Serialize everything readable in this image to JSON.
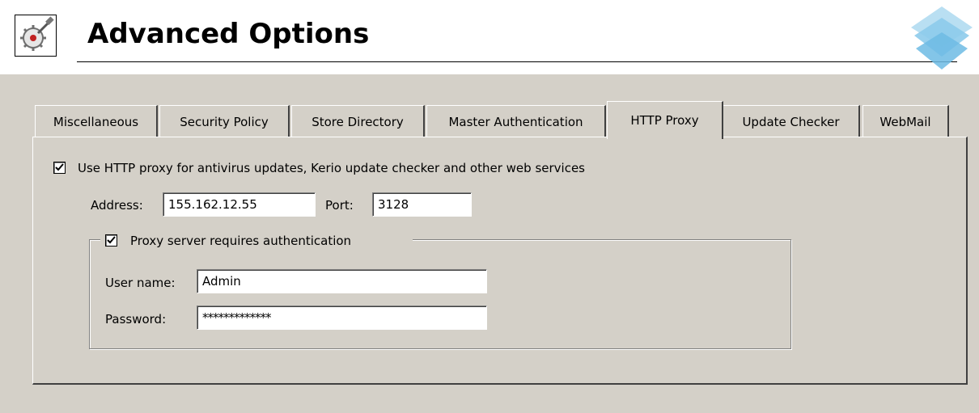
{
  "header": {
    "title": "Advanced Options",
    "icon": "settings-gear-wrench-icon",
    "logo": "kerio-logo-icon"
  },
  "tabs": [
    {
      "label": "Miscellaneous",
      "active": false
    },
    {
      "label": "Security Policy",
      "active": false
    },
    {
      "label": "Store Directory",
      "active": false
    },
    {
      "label": "Master Authentication",
      "active": false
    },
    {
      "label": "HTTP Proxy",
      "active": true
    },
    {
      "label": "Update Checker",
      "active": false
    },
    {
      "label": "WebMail",
      "active": false
    }
  ],
  "proxy": {
    "use_proxy_label": "Use HTTP proxy for antivirus updates, Kerio update checker and other web services",
    "use_proxy_checked": true,
    "address_label": "Address:",
    "address_value": "155.162.12.55",
    "port_label": "Port:",
    "port_value": "3128"
  },
  "auth": {
    "requires_auth_label": "Proxy server requires authentication",
    "requires_auth_checked": true,
    "username_label": "User name:",
    "username_value": "Admin",
    "password_label": "Password:",
    "password_value": "*************"
  },
  "colors": {
    "panel_bg": "#d4d0c8",
    "logo_blue": "#7fc6ea"
  }
}
